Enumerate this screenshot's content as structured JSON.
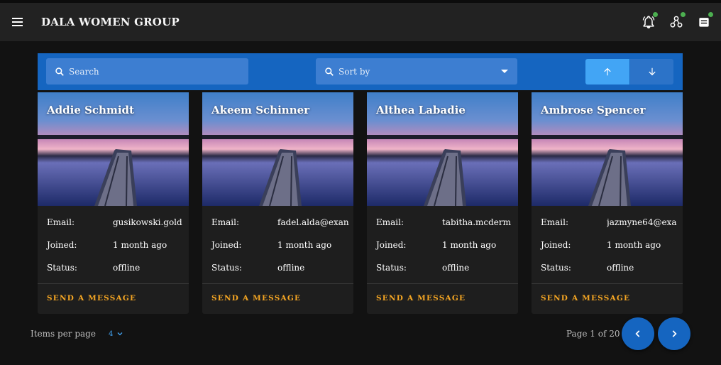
{
  "app": {
    "title": "DALA WOMEN GROUP"
  },
  "header": {
    "icons": [
      {
        "name": "notifications-icon",
        "badge_color": "#4caf50"
      },
      {
        "name": "groups-icon",
        "badge_color": "#4caf50"
      },
      {
        "name": "inbox-icon",
        "badge_color": "#4caf50"
      }
    ]
  },
  "toolbar": {
    "search_placeholder": "Search",
    "sort_placeholder": "Sort by",
    "sort_ascending_icon": "arrow-up-icon",
    "sort_descending_icon": "arrow-down-icon"
  },
  "labels": {
    "email": "Email:",
    "joined": "Joined:",
    "status": "Status:",
    "send_message": "SEND A MESSAGE"
  },
  "members": [
    {
      "name": "Addie Schmidt",
      "email": "gusikowski.gold",
      "joined": "1 month ago",
      "status": "offline"
    },
    {
      "name": "Akeem Schinner",
      "email": "fadel.alda@exan",
      "joined": "1 month ago",
      "status": "offline"
    },
    {
      "name": "Althea Labadie",
      "email": "tabitha.mcderm",
      "joined": "1 month ago",
      "status": "offline"
    },
    {
      "name": "Ambrose Spencer",
      "email": "jazmyne64@exa",
      "joined": "1 month ago",
      "status": "offline"
    }
  ],
  "pagination": {
    "items_per_page_label": "Items per page",
    "items_per_page_value": "4",
    "page_text": "Page 1 of 20"
  },
  "colors": {
    "primary": "#1565c0",
    "accent": "#f5a623",
    "background": "#121212",
    "card": "#1e1e1e"
  }
}
